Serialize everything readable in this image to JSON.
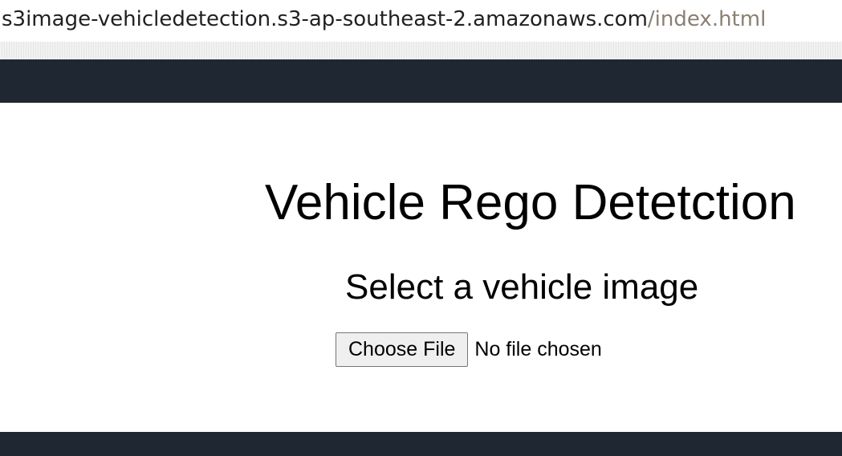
{
  "browser": {
    "url_host": "s3image-vehicledetection.s3-ap-southeast-2.amazonaws.com",
    "url_path": "/index.html",
    "loading_progress": 0.108
  },
  "page": {
    "title": "Vehicle Rego Detetction",
    "subtitle": "Select a vehicle image",
    "file_input": {
      "button_label": "Choose File",
      "status_text": "No file chosen"
    }
  },
  "colors": {
    "header_band": "#1f2732",
    "footer_band": "#1f2732",
    "url_path": "#8a7f73"
  }
}
